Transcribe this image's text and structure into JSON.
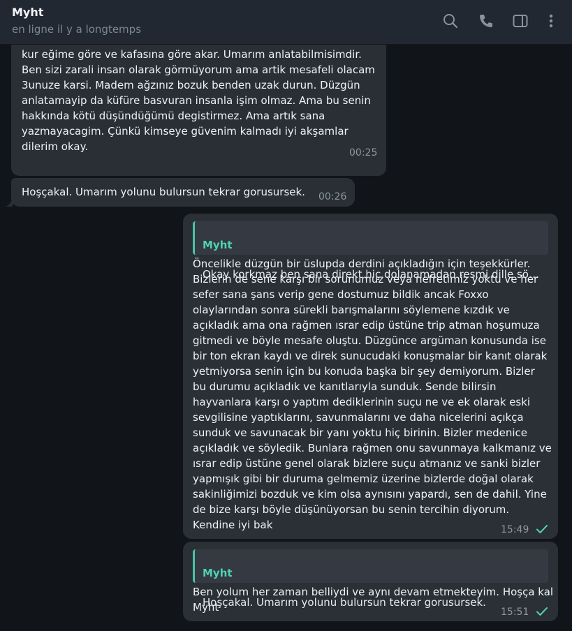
{
  "header": {
    "title": "Myht",
    "status": "en ligne il y a longtemps",
    "icons": [
      "search-icon",
      "phone-icon",
      "sidebar-icon",
      "more-icon"
    ]
  },
  "messages": [
    {
      "direction": "incoming",
      "text": "gözümde. Hayat sizin sözünüzü bakmaz. Suya istedigin kadar baraj\nkur eğime göre ve kafasına göre akar. Umarım anlatabilmisimdir.\nBen sizi zarali insan olarak görmüyorum ama artik mesafeli olacam\n3unuze karsi. Madem ağzınız bozuk benden uzak durun. Düzgün\nanlatamayip da küfüre basvuran insanla işim olmaz. Ama bu senin\nhakkında kötü düşündüğümü degistirmez. Ama artık sana\nyazmayacagim. Çünkü kimseye güvenim kalmadı iyi akşamlar\ndilerim okay.",
      "time": "00:25"
    },
    {
      "direction": "incoming",
      "text": "Hoşçakal. Umarım yolunu bulursun tekrar gorusursek.",
      "time": "00:26"
    },
    {
      "direction": "outgoing",
      "reply_name": "Myht",
      "reply_text": "Okay korkmaz ben sana direkt hiç dolanamadan resmi dille söy...",
      "text": "Öncelikle düzgün bir üslupda derdini açıkladığın için teşekkürler.\nBizlerin de sene karşı bir sorunumuz veya nefretimiz yoktu ve her\nsefer sana şans verip gene dostumuz bildik ancak Foxxo\nolaylarından sonra sürekli barışmalarını söylemene kızdık ve\naçıkladık ama ona rağmen ısrar edip üstüne trip atman hoşumuza\ngitmedi ve böyle mesafe oluştu. Düzgünce argüman konusunda ise\nbir ton ekran kaydı ve direk sunucudaki konuşmalar bir kanıt olarak\nyetmiyorsa senin için bu konuda başka bir şey demiyorum. Bizler\nbu durumu açıkladık ve kanıtlarıyla sunduk. Sende bilirsin\nhayvanlara karşı o yaptım dediklerinin suçu ne ve ek olarak eski\nsevgilisine yaptıklarını, savunmalarını ve daha nicelerini açıkça\nsunduk ve savunacak bir yanı yoktu hiç birinin. Bizler medenice\naçıkladık ve söyledik. Bunlara rağmen onu savunmaya kalkmanız ve\nısrar edip üstüne genel olarak bizlere suçu atmanız ve sanki bizler\nyapmışık gibi bir duruma gelmemiz üzerine bizlerde doğal olarak\nsakinliğimizi bozduk ve kim olsa aynısını yapardı, sen de dahil. Yine\nde bize karşı böyle düşünüyorsan bu senin tercihin diyorum.\nKendine iyi bak",
      "time": "15:49"
    },
    {
      "direction": "outgoing",
      "reply_name": "Myht",
      "reply_text": "Hoşçakal. Umarım yolunu bulursun tekrar gorusursek.",
      "text": "Ben yolum her zaman belliydi ve aynı devam etmekteyim. Hoşça kal\nMyht",
      "time": "15:51"
    }
  ],
  "colors": {
    "background": "#111418",
    "header": "#222831",
    "bubble": "#2a2f36",
    "accent": "#4fd1b4",
    "timestamp": "#8f989f"
  }
}
